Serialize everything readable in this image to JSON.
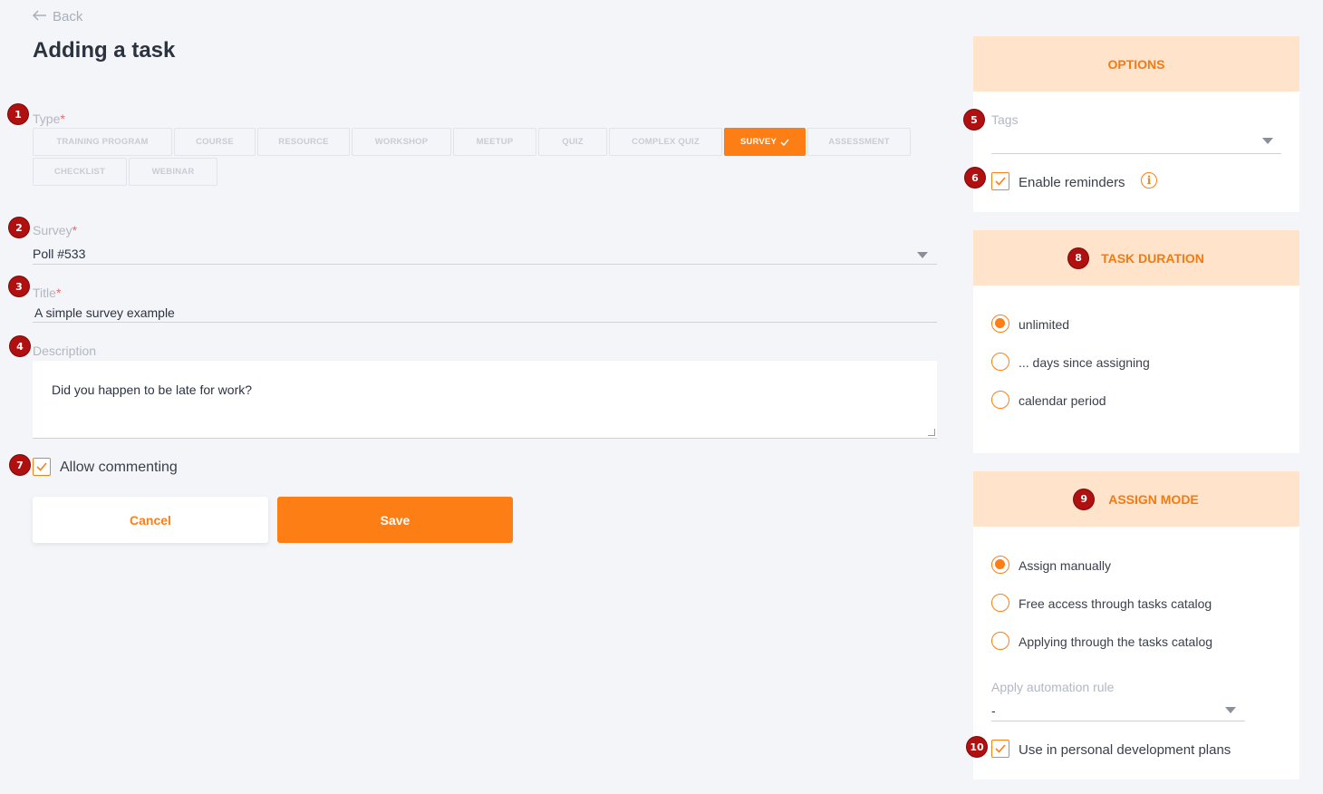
{
  "header": {
    "back_label": "Back",
    "title": "Adding a task"
  },
  "markers": [
    "1",
    "2",
    "3",
    "4",
    "5",
    "6",
    "7",
    "8",
    "9",
    "10"
  ],
  "type_field": {
    "label": "Type",
    "required_mark": "*",
    "options": [
      "TRAINING PROGRAM",
      "COURSE",
      "RESOURCE",
      "WORKSHOP",
      "MEETUP",
      "QUIZ",
      "COMPLEX QUIZ",
      "SURVEY",
      "ASSESSMENT",
      "CHECKLIST",
      "WEBINAR"
    ],
    "selected": "SURVEY"
  },
  "survey_field": {
    "label": "Survey",
    "required_mark": "*",
    "value": "Poll #533"
  },
  "title_field": {
    "label": "Title",
    "required_mark": "*",
    "value": "A simple survey example"
  },
  "description_field": {
    "label": "Description",
    "value": "Did you happen to be late for work?"
  },
  "allow_commenting": {
    "label": "Allow commenting",
    "checked": true
  },
  "buttons": {
    "cancel": "Cancel",
    "save": "Save"
  },
  "options_panel": {
    "title": "OPTIONS",
    "tags_label": "Tags",
    "enable_reminders": {
      "label": "Enable reminders",
      "checked": true
    }
  },
  "task_duration": {
    "title": "TASK DURATION",
    "options": [
      "unlimited",
      "... days since assigning",
      "calendar period"
    ],
    "selected": "unlimited"
  },
  "assign_mode": {
    "title": "ASSIGN MODE",
    "options": [
      "Assign manually",
      "Free access through tasks catalog",
      "Applying through the tasks catalog"
    ],
    "selected": "Assign manually",
    "automation_label": "Apply automation rule",
    "automation_value": "-",
    "personal_plans": {
      "label": "Use in personal development plans",
      "checked": true
    }
  },
  "colors": {
    "accent": "#fd7e14",
    "panel_header": "#ffe4cb",
    "marker": "#b01010"
  }
}
